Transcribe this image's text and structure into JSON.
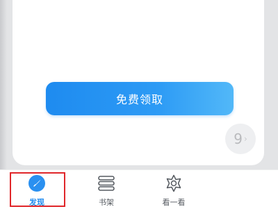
{
  "claim_button": {
    "label": "免费领取"
  },
  "counter_badge": {
    "value": "9",
    "chevron": "›"
  },
  "tabbar": {
    "tabs": [
      {
        "label": "发现",
        "icon": "compass-icon",
        "active": true
      },
      {
        "label": "书架",
        "icon": "bookshelf-icon",
        "active": false
      },
      {
        "label": "看一看",
        "icon": "sparkle-icon",
        "active": false
      }
    ]
  },
  "colors": {
    "accent": "#1e8bf0",
    "highlight": "#e0262a"
  }
}
